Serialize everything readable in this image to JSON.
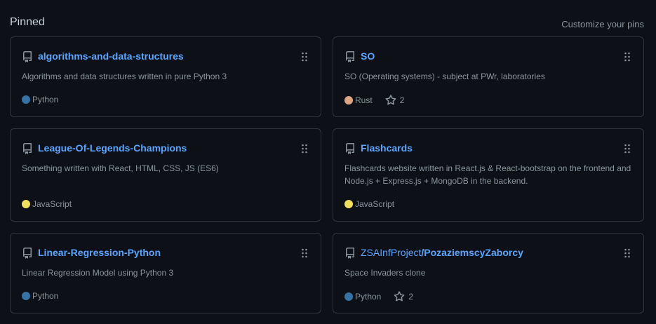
{
  "header": {
    "title": "Pinned",
    "customize_label": "Customize your pins"
  },
  "colors": {
    "python": "#3572A5",
    "rust": "#dea584",
    "javascript": "#f1e05a",
    "link": "#58a6ff"
  },
  "cards": [
    {
      "title": "algorithms-and-data-structures",
      "description": "Algorithms and data structures written in pure Python 3",
      "language": "Python",
      "lang_color": "#3572A5",
      "stars": ""
    },
    {
      "title": "SO",
      "description": "SO (Operating systems) - subject at PWr, laboratories",
      "language": "Rust",
      "lang_color": "#dea584",
      "stars": "2"
    },
    {
      "title": "League-Of-Legends-Champions",
      "description": "Something written with React, HTML, CSS, JS (ES6)",
      "language": "JavaScript",
      "lang_color": "#f1e05a",
      "stars": ""
    },
    {
      "title": "Flashcards",
      "description": "Flashcards website written in React.js & React-bootstrap on the frontend and Node.js + Express.js + MongoDB in the backend.",
      "language": "JavaScript",
      "lang_color": "#f1e05a",
      "stars": ""
    },
    {
      "title": "Linear-Regression-Python",
      "description": "Linear Regression Model using Python 3",
      "language": "Python",
      "lang_color": "#3572A5",
      "stars": ""
    },
    {
      "title_owner": "ZSAInfProject",
      "title_repo": "/PozaziemscyZaborcy",
      "description": "Space Invaders clone",
      "language": "Python",
      "lang_color": "#3572A5",
      "stars": "2"
    }
  ]
}
